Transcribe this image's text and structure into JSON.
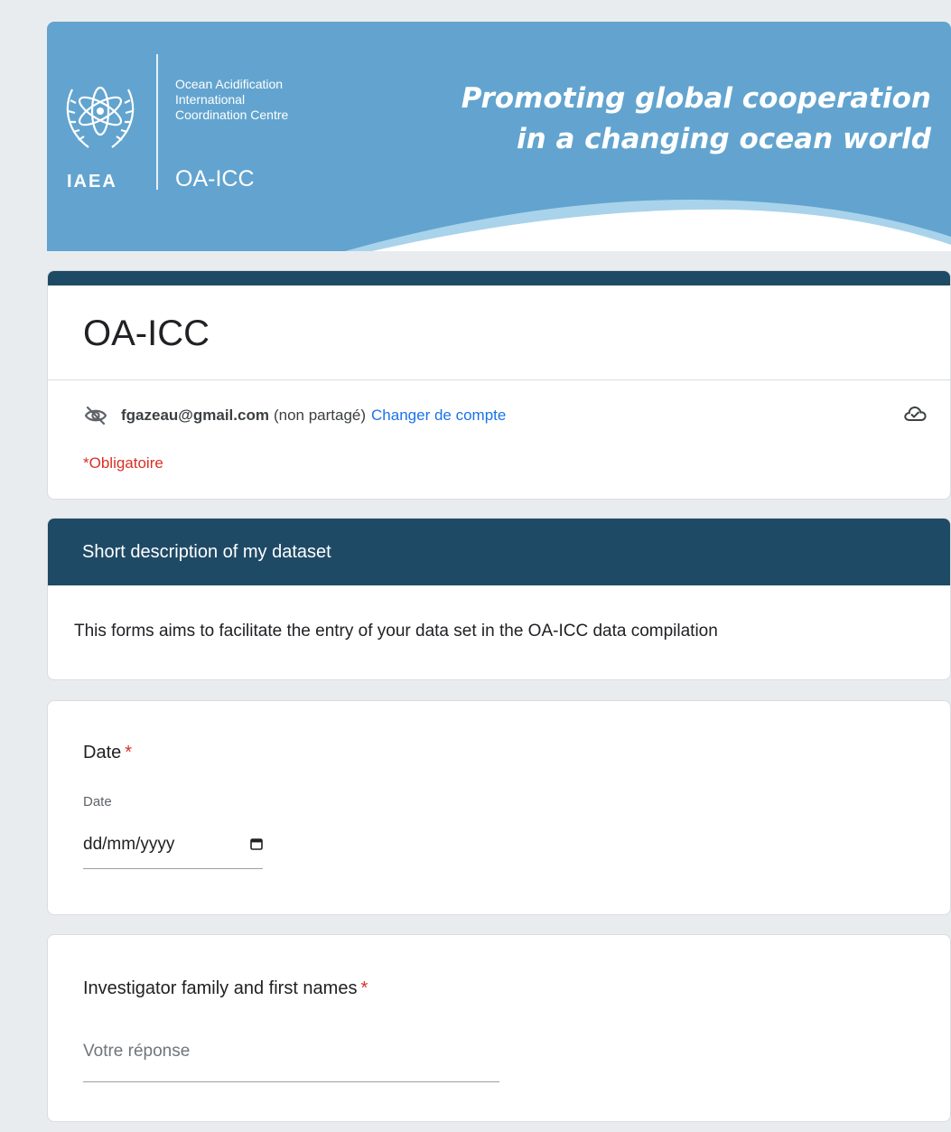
{
  "banner": {
    "org_line1": "Ocean Acidification",
    "org_line2": "International",
    "org_line3": "Coordination Centre",
    "org_abbr": "OA-ICC",
    "agency": "IAEA",
    "tagline_line1": "Promoting global cooperation",
    "tagline_line2": "in a changing ocean world"
  },
  "form": {
    "title": "OA-ICC",
    "account_email": "fgazeau@gmail.com",
    "account_shared_note": "(non partagé)",
    "switch_account_label": "Changer de compte",
    "required_note": "*Obligatoire"
  },
  "section": {
    "title": "Short description of my dataset",
    "description": "This forms aims to facilitate the entry of your data set in the OA-ICC data compilation"
  },
  "questions": [
    {
      "title": "Date",
      "required_mark": "*",
      "sub_label": "Date",
      "placeholder": "dd/mm/yyyy"
    },
    {
      "title": "Investigator family and first names",
      "required_mark": "*",
      "placeholder": "Votre réponse"
    }
  ],
  "icons": {
    "hidden_eye": "eye-off-icon",
    "cloud_saved": "cloud-check-icon",
    "calendar": "calendar-icon"
  },
  "colors": {
    "banner_blue": "#62a4cf",
    "header_dark": "#1f4a66",
    "required_red": "#d93025",
    "link_blue": "#1a73e8"
  }
}
